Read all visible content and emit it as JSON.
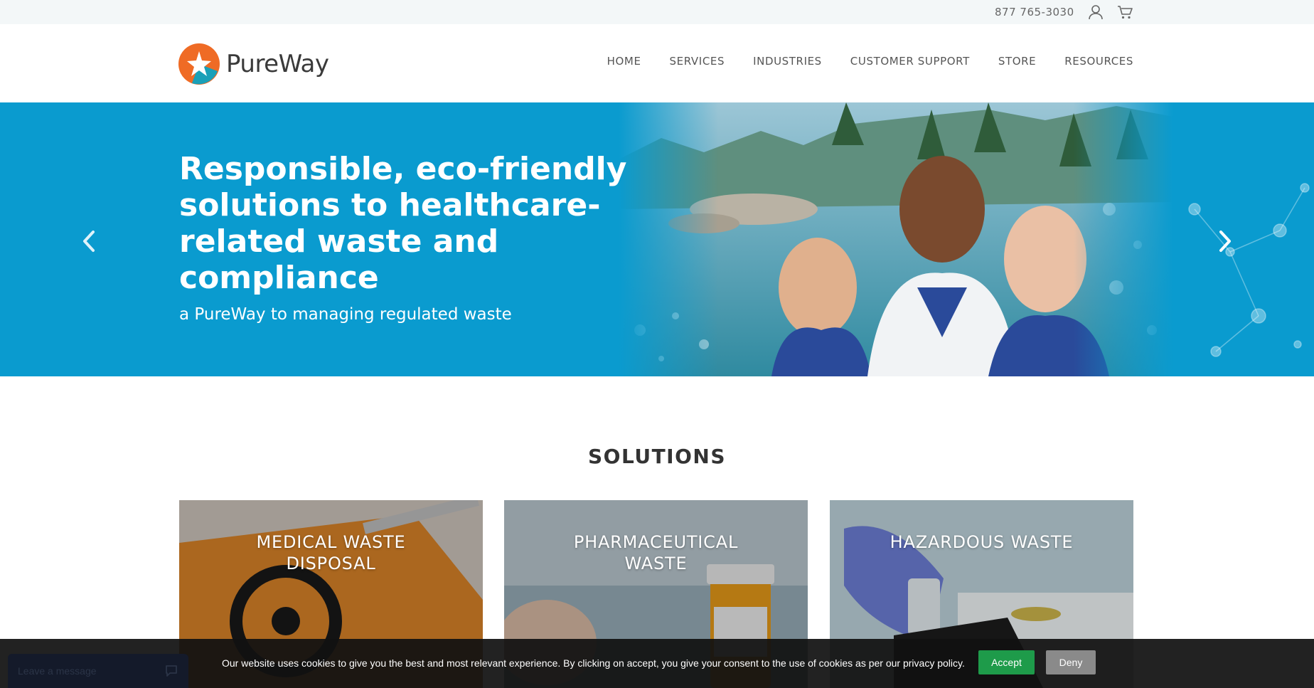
{
  "topbar": {
    "phone": "877 765-3030",
    "icons": [
      "account-icon",
      "cart-icon"
    ]
  },
  "header": {
    "logo_text": "PureWay",
    "nav": [
      "HOME",
      "SERVICES",
      "INDUSTRIES",
      "CUSTOMER SUPPORT",
      "STORE",
      "RESOURCES"
    ]
  },
  "hero": {
    "headline": "Responsible, eco-friendly solutions to healthcare-related waste and compliance",
    "subheadline": "a PureWay to managing regulated waste",
    "background_color": "#0a9bcf"
  },
  "solutions": {
    "title": "SOLUTIONS",
    "cards": [
      {
        "label": "MEDICAL WASTE DISPOSAL"
      },
      {
        "label": "PHARMACEUTICAL WASTE"
      },
      {
        "label": "HAZARDOUS WASTE"
      }
    ]
  },
  "cookie_banner": {
    "message": "Our website uses cookies to give you the best and most relevant experience. By clicking on accept, you give your consent to the use of cookies as per our privacy policy.",
    "accept_label": "Accept",
    "deny_label": "Deny",
    "accept_color": "#1e9b4a",
    "deny_color": "#8a8a8a"
  },
  "chat_widget": {
    "label": "Leave a message"
  },
  "colors": {
    "brand_orange": "#ef6b25",
    "brand_teal": "#1aa0b8"
  }
}
